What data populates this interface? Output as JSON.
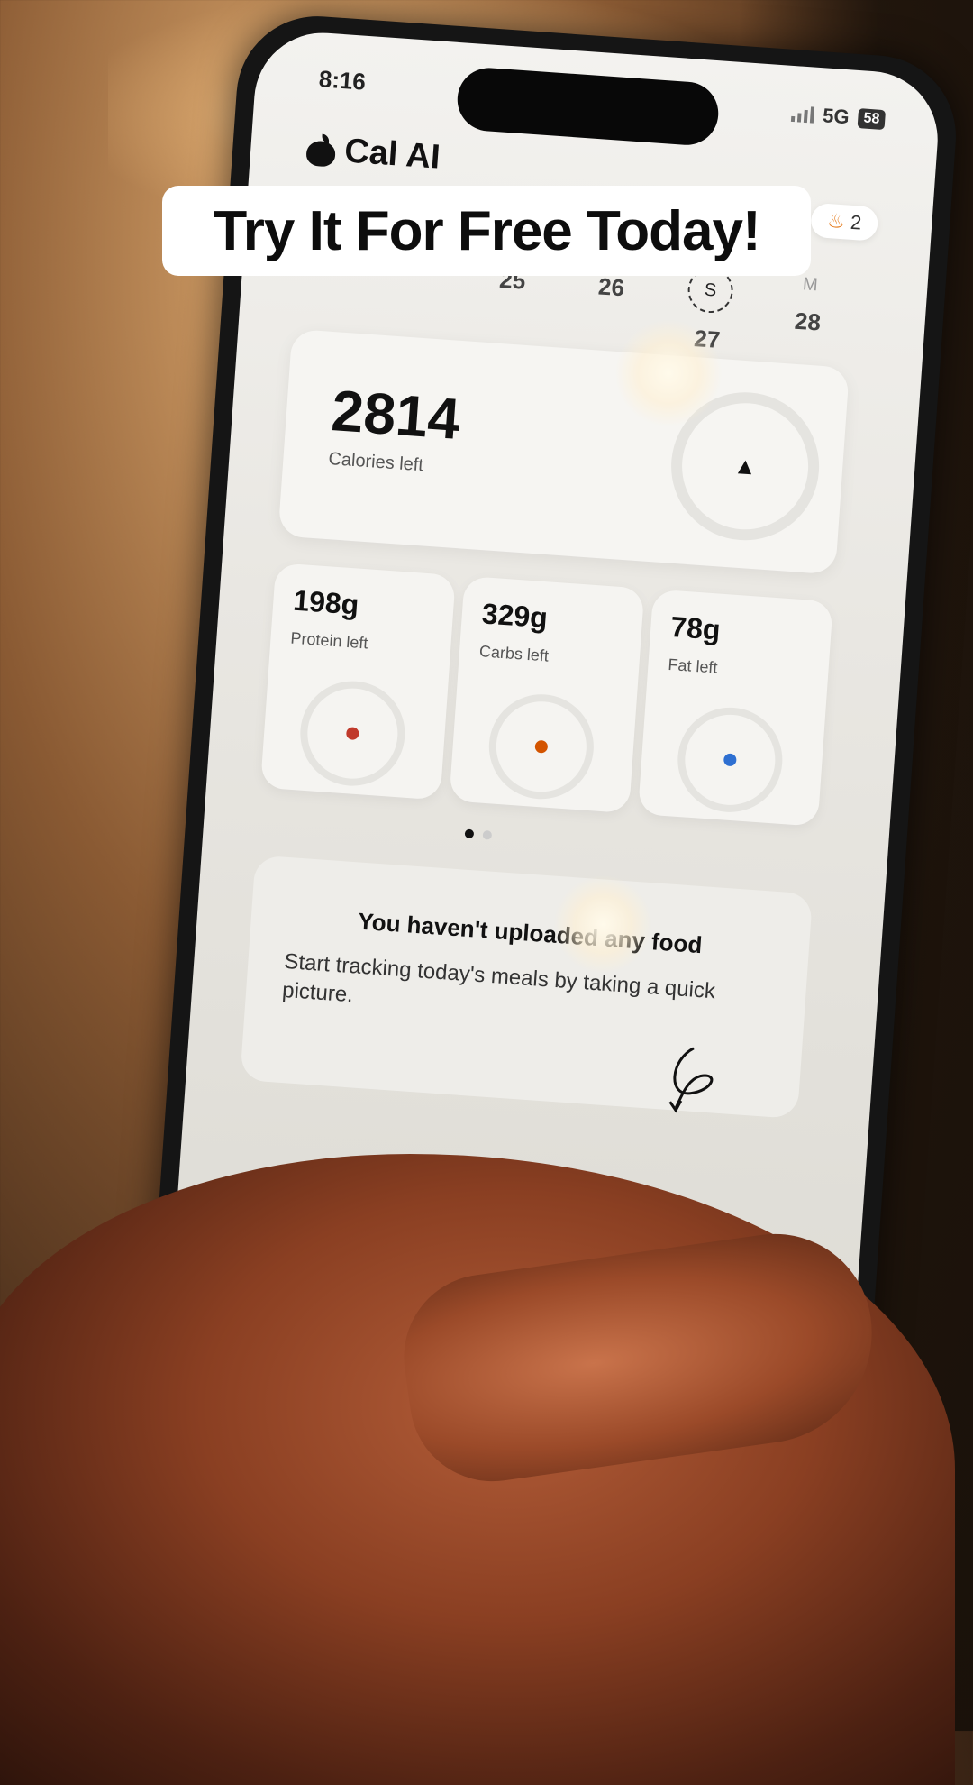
{
  "status_bar": {
    "time": "8:16",
    "network": "5G",
    "battery": "58"
  },
  "app": {
    "name": "Cal AI"
  },
  "streak": {
    "count": "2"
  },
  "days": [
    {
      "letter": "",
      "num": "25"
    },
    {
      "letter": "",
      "num": "26"
    },
    {
      "letter": "S",
      "num": "27"
    },
    {
      "letter": "M",
      "num": "28"
    }
  ],
  "calories": {
    "value": "2814",
    "label": "Calories left"
  },
  "macros": [
    {
      "value": "198g",
      "label": "Protein left",
      "color": "#c0392b"
    },
    {
      "value": "329g",
      "label": "Carbs left",
      "color": "#d35400"
    },
    {
      "value": "78g",
      "label": "Fat left",
      "color": "#2e6fd1"
    }
  ],
  "empty_state": {
    "title": "You haven't uploaded any food",
    "subtitle": "Start tracking today's meals by taking a quick picture."
  },
  "caption": "Try It For Free Today!"
}
